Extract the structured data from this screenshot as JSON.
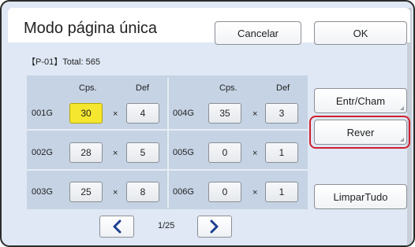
{
  "window": {
    "title": "Modo página única"
  },
  "toolbar": {
    "cancel_label": "Cancelar",
    "ok_label": "OK"
  },
  "info": {
    "program": "【P-01】",
    "total_label": "Total: 565"
  },
  "columns": {
    "copies": "Cps.",
    "sets": "Def"
  },
  "rows": [
    {
      "id": "001G",
      "cps": "30",
      "def": "4",
      "selected": true
    },
    {
      "id": "002G",
      "cps": "28",
      "def": "5"
    },
    {
      "id": "003G",
      "cps": "25",
      "def": "8"
    },
    {
      "id": "004G",
      "cps": "35",
      "def": "3"
    },
    {
      "id": "005G",
      "cps": "0",
      "def": "1"
    },
    {
      "id": "006G",
      "cps": "0",
      "def": "1"
    }
  ],
  "multiply_symbol": "×",
  "side_buttons": {
    "entr_cham": "Entr/Cham",
    "rever": "Rever",
    "limpar_tudo": "LimparTudo"
  },
  "pagination": {
    "label": "1/25",
    "prev_icon": "chevron-left-icon",
    "next_icon": "chevron-right-icon"
  },
  "colors": {
    "selected_cell": "#f5e62f",
    "highlight_ring": "#d01f2f",
    "panel": "#c5d3e4",
    "nav_arrow": "#1c3f8f"
  }
}
